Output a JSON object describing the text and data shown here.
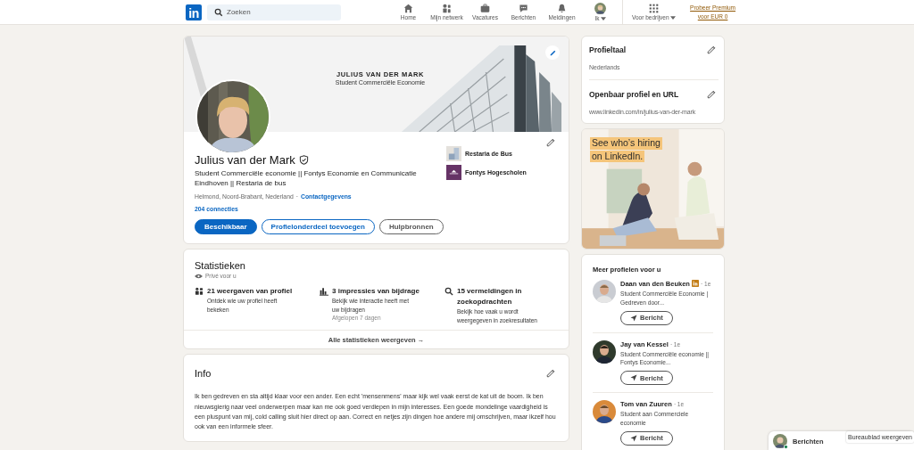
{
  "nav": {
    "logo": "in",
    "search": {
      "placeholder": "Zoeken"
    },
    "items": [
      {
        "label": "Home",
        "kind": "home"
      },
      {
        "label": "Mijn netwerk",
        "kind": "network"
      },
      {
        "label": "Vacatures",
        "kind": "jobs"
      },
      {
        "label": "Berichten",
        "kind": "messages"
      },
      {
        "label": "Meldingen",
        "kind": "bell"
      },
      {
        "label": "Ik",
        "kind": "me"
      }
    ],
    "business": "Voor bedrijven",
    "premium": "Probeer Premium voor EUR 0"
  },
  "profile": {
    "banner": {
      "title": "JULIUS VAN DER MARK",
      "subtitle": "Student Commerciële Economie"
    },
    "name": "Julius van der Mark",
    "verified": true,
    "headline": "Student Commerciële economie || Fontys Economie en Communicatie Eindhoven || Restaria de bus",
    "location": "Helmond, Noord-Brabant, Nederland",
    "separator": "·",
    "contact_link": "Contactgegevens",
    "connections": "204 connecties",
    "buttons": [
      {
        "label": "Beschikbaar",
        "kind": "primary"
      },
      {
        "label": "Profielonderdeel toevoegen",
        "kind": "outline"
      },
      {
        "label": "Hulpbronnen",
        "kind": "secondary"
      }
    ],
    "organizations": [
      {
        "name": "Restaria de Bus",
        "kind": "restaurant"
      },
      {
        "name": "Fontys Hogescholen",
        "kind": "school"
      }
    ]
  },
  "statistics": {
    "title": "Statistieken",
    "privacy": "Privé voor u",
    "items": [
      {
        "kind": "people",
        "title": "21 weergaven van profiel",
        "description": "Ontdek wie uw profiel heeft bekeken"
      },
      {
        "kind": "bars",
        "title": "3 impressies van bijdrage",
        "description": "Bekijk wie interactie heeft met uw bijdragen",
        "note": "Afgelopen 7 dagen"
      },
      {
        "kind": "search",
        "title": "15 vermeldingen in zoekopdrachten",
        "description": "Bekijk hoe vaak u wordt weergegeven in zoekresultaten"
      }
    ],
    "footer": "Alle statistieken weergeven →"
  },
  "info": {
    "title": "Info",
    "text": "Ik ben gedreven en sta altijd klaar voor een ander. Een echt 'mensenmens' maar kijk wel vaak eerst de kat uit de boom. Ik ben nieuwsgierig naar veel onderwerpen maar kan me ook goed verdiepen in mijn interesses. Een goede mondelinge vaardigheid is een pluspunt van mij, cold calling sluit hier direct op aan. Correct en netjes zijn dingen hoe andere mij omschrijven, maar ikzelf hou ook van een informele sfeer."
  },
  "settings": [
    {
      "title": "Profieltaal",
      "value": "Nederlands"
    },
    {
      "title": "Openbaar profiel en URL",
      "value": "www.linkedin.com/in/julius-van-der-mark"
    }
  ],
  "ad": {
    "lines": [
      "See who’s hiring",
      "on LinkedIn."
    ]
  },
  "suggestions": {
    "title": "Meer profielen voor u",
    "people": [
      {
        "name": "Daan van den Beuken",
        "premium": true,
        "degree": "· 1e",
        "headline": "Student Commerciële Economie | Gedreven door...",
        "button": "Bericht"
      },
      {
        "name": "Jay van Kessel",
        "premium": false,
        "degree": "· 1e",
        "headline": "Student Commerciële economie || Fontys Economie...",
        "button": "Bericht"
      },
      {
        "name": "Tom van Zuuren",
        "premium": false,
        "degree": "· 1e",
        "headline": "Student aan Commerciele economie",
        "button": "Bericht"
      }
    ]
  },
  "messaging": {
    "label": "Berichten",
    "online": true
  },
  "tooltip": "Bureaublad weergeven"
}
